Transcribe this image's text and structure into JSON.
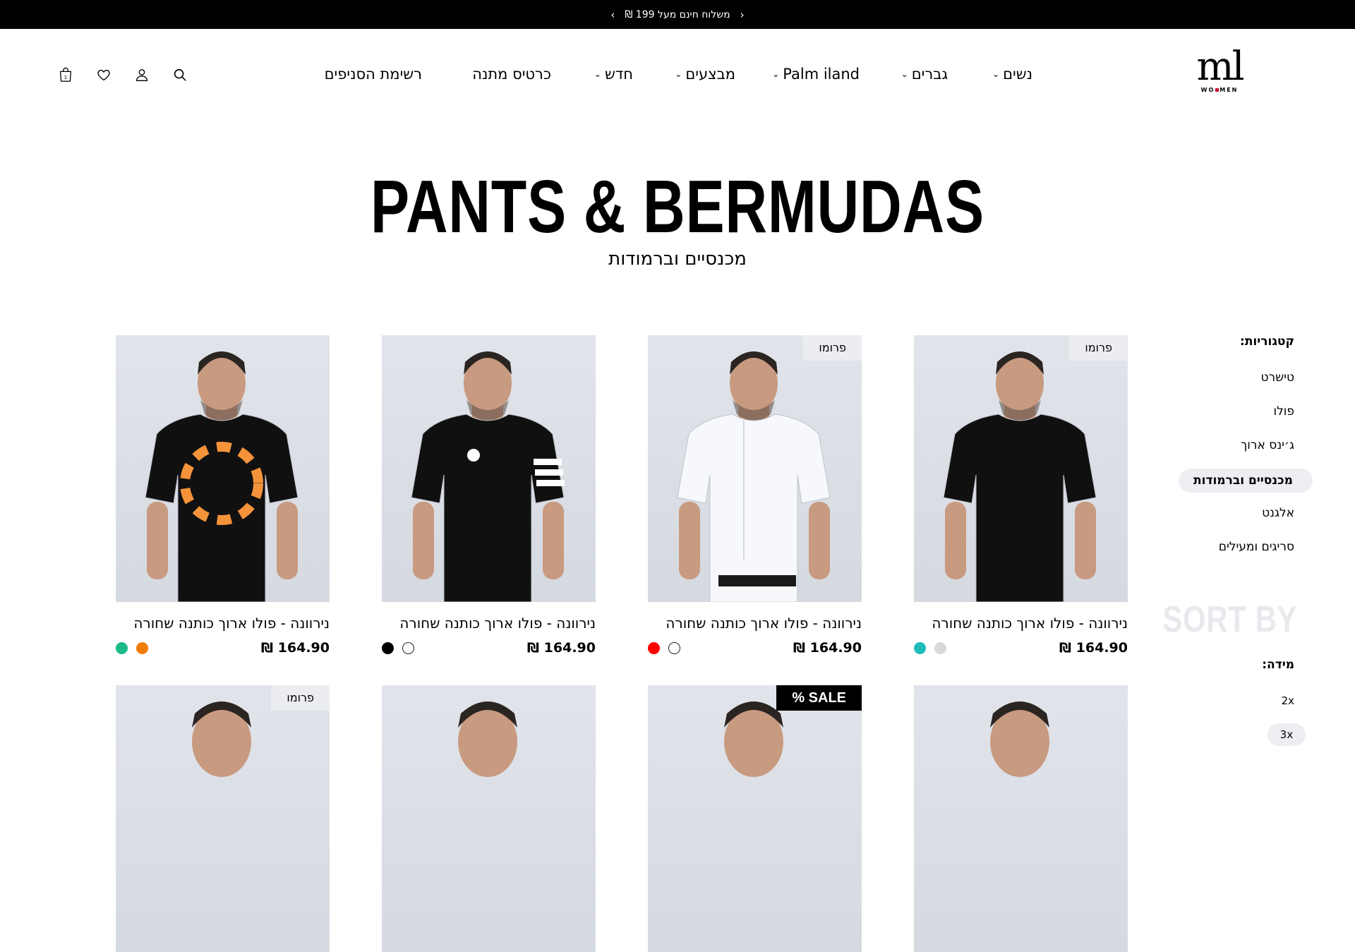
{
  "announcement": {
    "text": "משלוח חינם מעל 199 ₪",
    "prev_icon": "chevron-left-icon",
    "next_icon": "chevron-right-icon"
  },
  "header": {
    "logo": {
      "main": "ml",
      "sub": "WOMEN"
    },
    "nav": [
      {
        "label": "נשים",
        "has_dropdown": true
      },
      {
        "label": "גברים",
        "has_dropdown": true
      },
      {
        "label": "Palm iland",
        "has_dropdown": true
      },
      {
        "label": "מבצעים",
        "has_dropdown": true
      },
      {
        "label": "חדש",
        "has_dropdown": true
      },
      {
        "label": "כרטיס מתנה",
        "has_dropdown": false
      },
      {
        "label": "רשימת הסניפים",
        "has_dropdown": false
      }
    ],
    "icons": [
      "search-icon",
      "user-icon",
      "heart-icon",
      "shopping-bag-icon"
    ],
    "cart_count": "1"
  },
  "hero": {
    "title": "PANTS & BERMUDAS",
    "subtitle": "מכנסיים וברמודות"
  },
  "sidebar": {
    "categories_heading": "קטגוריות:",
    "categories": [
      {
        "label": "טישרט",
        "active": false
      },
      {
        "label": "פולו",
        "active": false
      },
      {
        "label": "ג׳ינס ארוך",
        "active": false
      },
      {
        "label": "מכנסיים וברמודות",
        "active": true
      },
      {
        "label": "אלגנט",
        "active": false
      },
      {
        "label": "סריגים ומעילים",
        "active": false
      }
    ],
    "sort_by": "SORT BY",
    "size_heading": "מידה:",
    "sizes": [
      {
        "label": "2x",
        "active": false
      },
      {
        "label": "3x",
        "active": true
      }
    ]
  },
  "products": [
    {
      "name": "נירוונה - פולו ארוך כותנה שחורה",
      "price": "164.90 ₪",
      "badge": "פרומו",
      "badge_type": "promo",
      "swatches": [
        "#1fbcb8",
        "#d9d9d9"
      ],
      "outline": [
        false,
        false
      ],
      "shirt": "tee-black"
    },
    {
      "name": "נירוונה - פולו ארוך כותנה שחורה",
      "price": "164.90 ₪",
      "badge": "פרומו",
      "badge_type": "promo",
      "swatches": [
        "#ff0000",
        "#ffffff"
      ],
      "outline": [
        false,
        true
      ],
      "shirt": "shirt-white"
    },
    {
      "name": "נירוונה - פולו ארוך כותנה שחורה",
      "price": "164.90 ₪",
      "badge": "",
      "badge_type": "",
      "swatches": [
        "#000000",
        "#ffffff"
      ],
      "outline": [
        false,
        true
      ],
      "shirt": "polo-black"
    },
    {
      "name": "נירוונה - פולו ארוך כותנה שחורה",
      "price": "164.90 ₪",
      "badge": "",
      "badge_type": "",
      "swatches": [
        "#1cb98a",
        "#f07d0a"
      ],
      "outline": [
        false,
        false
      ],
      "shirt": "tee-print"
    },
    {
      "name": "",
      "price": "",
      "badge": "",
      "badge_type": "",
      "swatches": [],
      "outline": [],
      "shirt": "partial"
    },
    {
      "name": "",
      "price": "",
      "badge": "SALE %",
      "badge_type": "sale",
      "swatches": [],
      "outline": [],
      "shirt": "partial"
    },
    {
      "name": "",
      "price": "",
      "badge": "",
      "badge_type": "",
      "swatches": [],
      "outline": [],
      "shirt": "partial"
    },
    {
      "name": "",
      "price": "",
      "badge": "פרומו",
      "badge_type": "promo",
      "swatches": [],
      "outline": [],
      "shirt": "partial"
    }
  ]
}
